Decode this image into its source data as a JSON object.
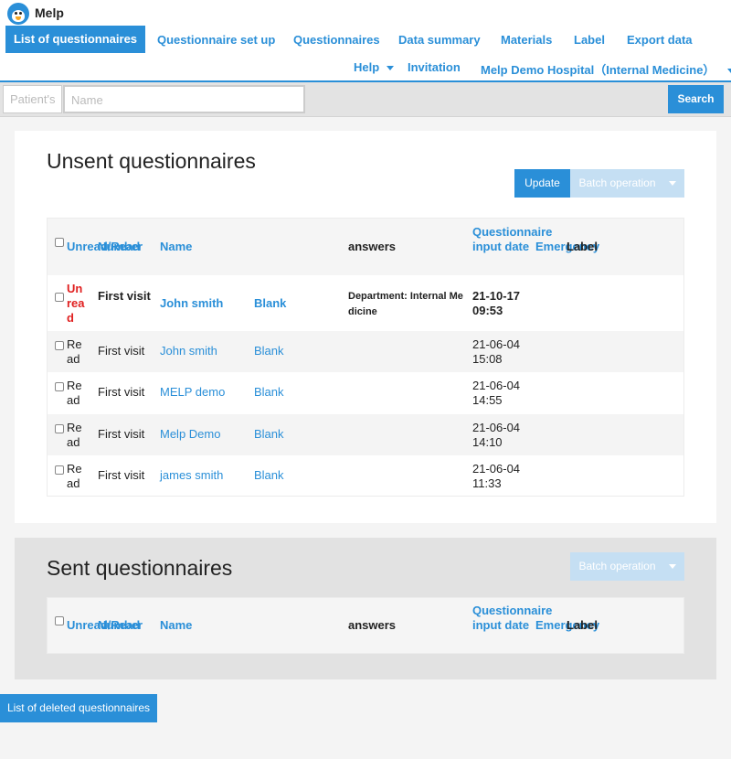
{
  "app": {
    "title": "Melp"
  },
  "nav": {
    "items": [
      "List of questionnaires",
      "Questionnaire set up",
      "Questionnaires",
      "Data summary",
      "Materials",
      "Label",
      "Export data"
    ],
    "help": "Help",
    "invitation": "Invitation",
    "hospital": "Melp Demo Hospital（Internal Medicine）"
  },
  "search": {
    "patient_placeholder": "Patient's",
    "name_placeholder": "Name",
    "button": "Search"
  },
  "unsent": {
    "title": "Unsent questionnaires",
    "update_button": "Update",
    "batch_button": "Batch operation",
    "columns": {
      "unread": "Unread/Read",
      "number": "Number",
      "name": "Name",
      "answers": "answers",
      "date": "Questionnaire input date",
      "emergency": "Emergency",
      "label": "Label"
    },
    "rows": [
      {
        "status": "Unread",
        "visit": "First visit",
        "name": "John smith",
        "answer": "Blank",
        "department": "Department: Internal Medicine",
        "date": "21-10-17",
        "time": "09:53"
      },
      {
        "status": "Read",
        "visit": "First visit",
        "name": "John smith",
        "answer": "Blank",
        "department": "",
        "date": "21-06-04",
        "time": "15:08"
      },
      {
        "status": "Read",
        "visit": "First visit",
        "name": "MELP demo",
        "answer": "Blank",
        "department": "",
        "date": "21-06-04",
        "time": "14:55"
      },
      {
        "status": "Read",
        "visit": "First visit",
        "name": "Melp Demo",
        "answer": "Blank",
        "department": "",
        "date": "21-06-04",
        "time": "14:10"
      },
      {
        "status": "Read",
        "visit": "First visit",
        "name": "james smith",
        "answer": "Blank",
        "department": "",
        "date": "21-06-04",
        "time": "11:33"
      }
    ]
  },
  "sent": {
    "title": "Sent questionnaires",
    "batch_button": "Batch operation",
    "columns": {
      "unread": "Unread/Read",
      "number": "Number",
      "name": "Name",
      "answers": "answers",
      "date": "Questionnaire input date",
      "emergency": "Emergency",
      "label": "Label"
    }
  },
  "deleted_button": "List of deleted questionnaires",
  "colors": {
    "primary": "#2a8fd8",
    "unread": "#e02020",
    "disabled": "#c5dff3"
  },
  "icons": {
    "logo": "penguin-logo-icon",
    "dropdown": "caret-down-icon"
  }
}
